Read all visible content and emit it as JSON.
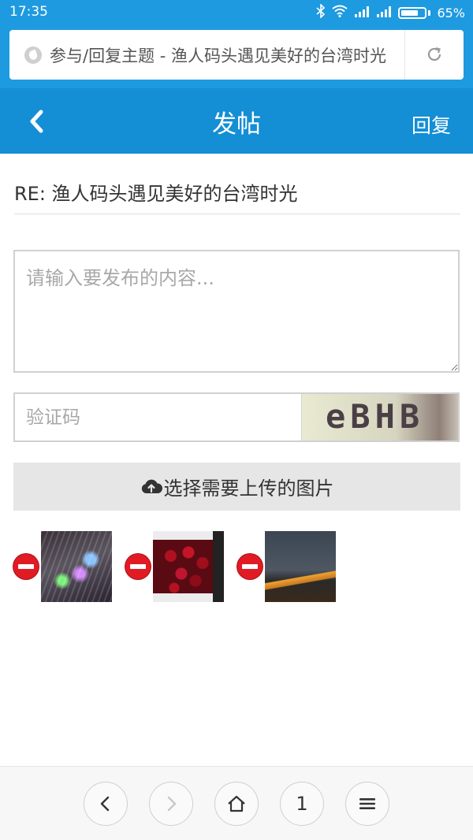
{
  "status_bar": {
    "time": "17:35",
    "battery_percent": "65%",
    "icons": [
      "bluetooth-icon",
      "wifi-icon",
      "signal-icon",
      "signal-icon",
      "battery-icon"
    ]
  },
  "browser": {
    "url_text": "参与/回复主题 - 渔人码头遇见美好的台湾时光",
    "reload_icon": "reload-icon"
  },
  "header": {
    "back_icon": "chevron-left-icon",
    "title": "发帖",
    "reply_label": "回复"
  },
  "form": {
    "subject": "RE: 渔人码头遇见美好的台湾时光",
    "content_placeholder": "请输入要发布的内容...",
    "captcha_placeholder": "验证码",
    "captcha_text": "eBHB",
    "upload_label": "选择需要上传的图片",
    "upload_icon": "cloud-upload-icon"
  },
  "attachments": [
    {
      "remove_icon": "remove-icon",
      "thumb": "led-lights-photo"
    },
    {
      "remove_icon": "remove-icon",
      "thumb": "cherries-box-photo"
    },
    {
      "remove_icon": "remove-icon",
      "thumb": "city-night-photo"
    }
  ],
  "bottom_nav": {
    "items": [
      "back-icon",
      "forward-icon",
      "home-icon",
      "tabs-count",
      "menu-icon"
    ],
    "tabs_count": "1",
    "forward_disabled": true
  },
  "colors": {
    "status_bar": "#1e9ae0",
    "header": "#148ed5",
    "remove_red": "#e01b24"
  }
}
